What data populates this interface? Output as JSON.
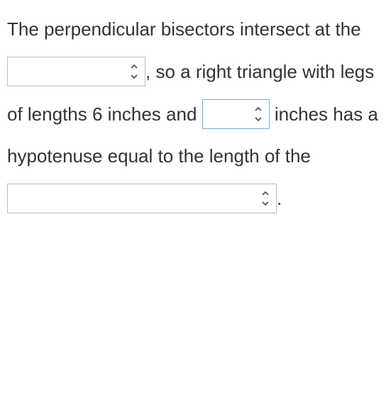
{
  "text": {
    "t1": "The perpendicular bisectors intersect at the ",
    "t2": ", so a right triangle with legs of lengths 6 inches and ",
    "t3": "inches has a hypotenuse equal to the length of the ",
    "t4": "."
  },
  "selects": {
    "s1": "",
    "s2": "",
    "s3": ""
  }
}
